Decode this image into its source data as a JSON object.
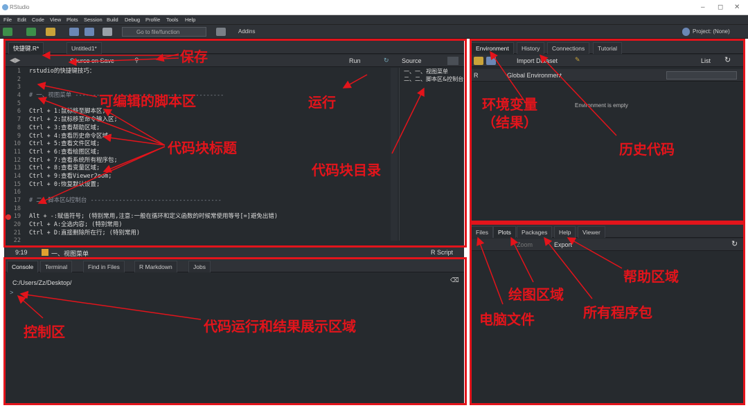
{
  "window": {
    "title": "RStudio",
    "min": "–",
    "max": "◻",
    "close": "✕"
  },
  "menu": [
    "File",
    "Edit",
    "Code",
    "View",
    "Plots",
    "Session",
    "Build",
    "Debug",
    "Profile",
    "Tools",
    "Help"
  ],
  "toolbar": {
    "goto_placeholder": "Go to file/function",
    "addins": "Addins",
    "project": "Project: (None)"
  },
  "editor": {
    "tabs": [
      {
        "label": "快捷键.R*"
      },
      {
        "label": "Untitled1*"
      }
    ],
    "source_on_save": "Source on Save",
    "run": "Run",
    "source": "Source",
    "lines": [
      {
        "n": "1",
        "t": "rstudio的快捷键技巧："
      },
      {
        "n": "2",
        "t": ""
      },
      {
        "n": "3",
        "t": ""
      },
      {
        "n": "4",
        "t": "# 一、视图菜单 ------------------------------------------"
      },
      {
        "n": "5",
        "t": ""
      },
      {
        "n": "6",
        "t": "Ctrl + 1:鼠标移至脚本区;"
      },
      {
        "n": "7",
        "t": "Ctrl + 2:鼠标移至命令输入区;"
      },
      {
        "n": "8",
        "t": "Ctrl + 3:查看帮助区域;"
      },
      {
        "n": "9",
        "t": "Ctrl + 4:查看历史命令区域;"
      },
      {
        "n": "10",
        "t": "Ctrl + 5:查看文件区域;"
      },
      {
        "n": "11",
        "t": "Ctrl + 6:查看绘图区域;"
      },
      {
        "n": "12",
        "t": "Ctrl + 7:查看系统所有程序包;"
      },
      {
        "n": "13",
        "t": "Ctrl + 8:查看变量区域;"
      },
      {
        "n": "14",
        "t": "Ctrl + 9:查看Viewer2oom;"
      },
      {
        "n": "15",
        "t": "Ctrl + 0:恢复默认设置;"
      },
      {
        "n": "16",
        "t": ""
      },
      {
        "n": "17",
        "t": "# 二、脚本区&控制台 -------------------------------------"
      },
      {
        "n": "18",
        "t": ""
      },
      {
        "n": "19",
        "t": "Alt + -:赋值符号; (特别常用,注意:一般在循环和定义函数的时候常使用等号[=]避免出错)"
      },
      {
        "n": "20",
        "t": "Ctrl + A:全选内容; (特别常用)"
      },
      {
        "n": "21",
        "t": "Ctrl + D:直接删除所在行; (特别常用)"
      },
      {
        "n": "22",
        "t": ""
      }
    ],
    "outline": [
      "一、视图菜单",
      "二、脚本区&控制台"
    ],
    "status_pos": "9:19",
    "status_section": "一、视图菜单",
    "status_type": "R Script"
  },
  "console": {
    "tabs": [
      "Console",
      "Terminal",
      "Find in Files",
      "R Markdown",
      "Jobs"
    ],
    "path": "C:/Users/Zz/Desktop/",
    "prompt": ">"
  },
  "env": {
    "tabs": [
      "Environment",
      "History",
      "Connections",
      "Tutorial"
    ],
    "import": "Import Dataset",
    "list": "List",
    "lang": "R",
    "global": "Global Environment",
    "empty": "Environment is empty"
  },
  "files": {
    "tabs": [
      "Files",
      "Plots",
      "Packages",
      "Help",
      "Viewer"
    ],
    "zoom": "Zoom",
    "export": "Export"
  },
  "annotations": {
    "save": "保存",
    "editable": "可编辑的脚本区",
    "run": "运行",
    "chunk_title": "代码块标题",
    "chunk_toc": "代码块目录",
    "env_var": "环境变量\n（结果）",
    "history": "历史代码",
    "console": "控制区",
    "output": "代码运行和结果展示区域",
    "help": "帮助区域",
    "plot": "绘图区域",
    "packages": "所有程序包",
    "files": "电脑文件"
  },
  "colors": {
    "annotation": "#e3141b",
    "pane_bg": "#262a2e",
    "chrome": "#2f3237"
  }
}
